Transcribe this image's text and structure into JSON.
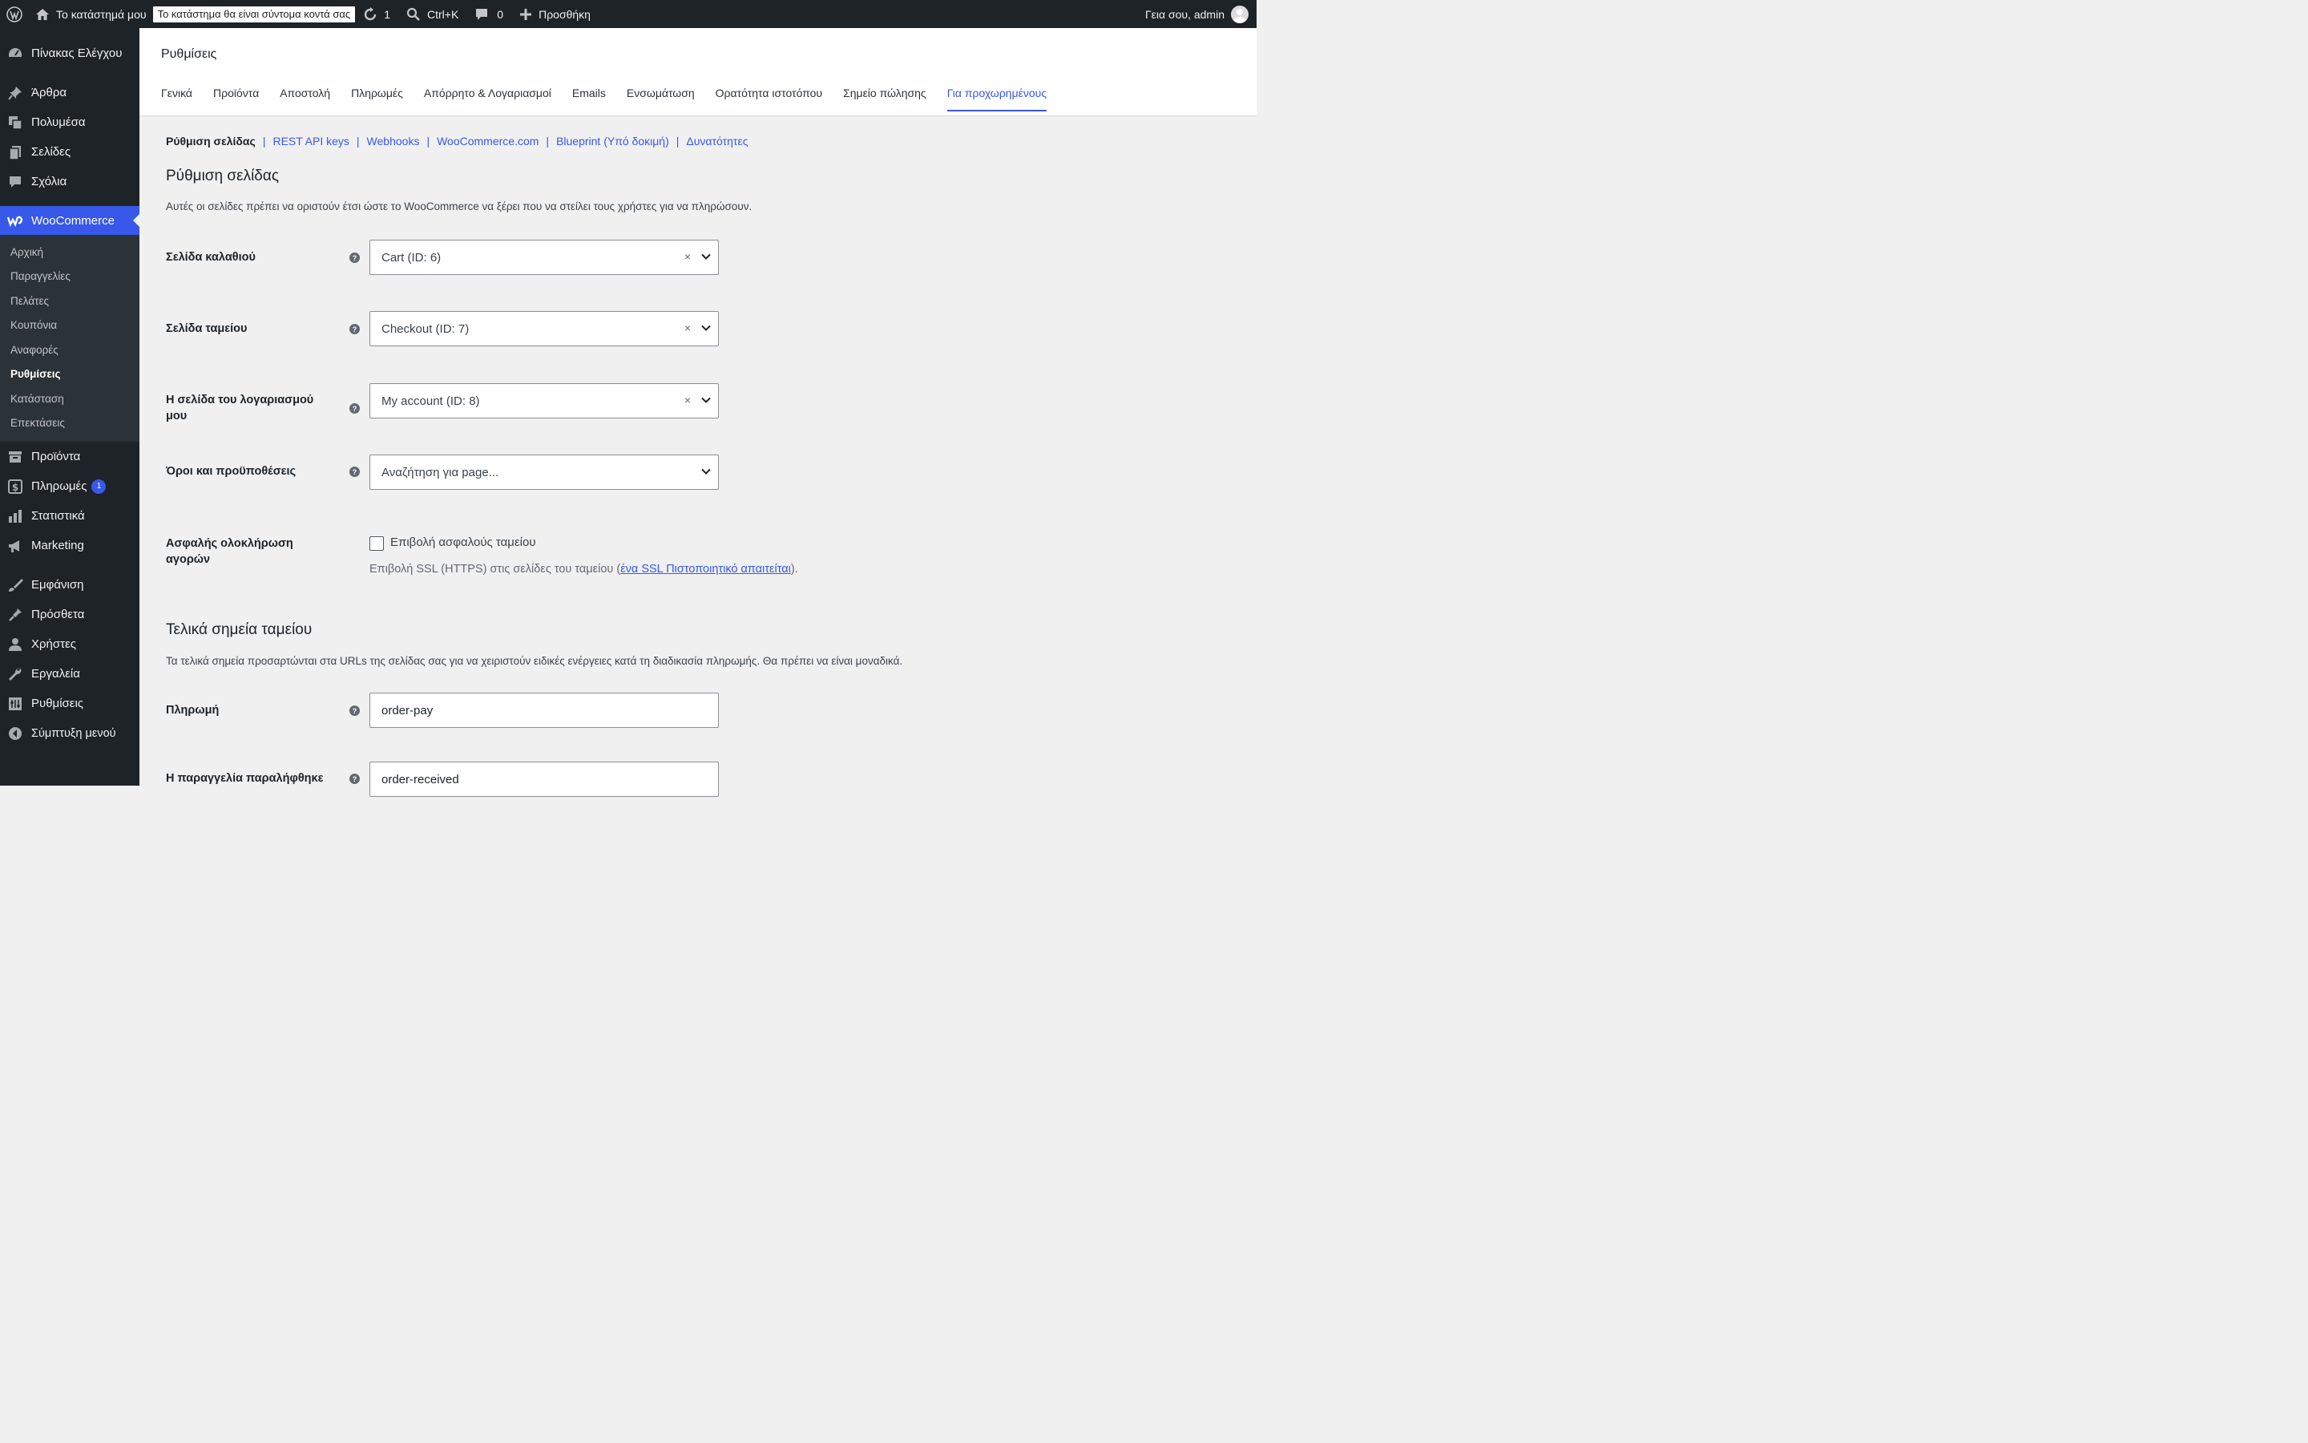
{
  "admin_bar": {
    "site_name": "Το κατάστημά μου",
    "maintenance_notice": "Το κατάστημα θα είναι σύντομα κοντά σας",
    "updates_count": "1",
    "command_shortcut": "Ctrl+K",
    "comments_count": "0",
    "new_label": "Προσθήκη",
    "greeting": "Γεια σου, admin"
  },
  "sidebar": {
    "dashboard": "Πίνακας Ελέγχου",
    "posts": "Άρθρα",
    "media": "Πολυμέσα",
    "pages": "Σελίδες",
    "comments": "Σχόλια",
    "woocommerce": "WooCommerce",
    "woo_sub": [
      "Αρχική",
      "Παραγγελίες",
      "Πελάτες",
      "Κουπόνια",
      "Αναφορές",
      "Ρυθμίσεις",
      "Κατάσταση",
      "Επεκτάσεις"
    ],
    "products": "Προϊόντα",
    "payments": "Πληρωμές",
    "payments_badge": "1",
    "analytics": "Στατιστικά",
    "marketing": "Marketing",
    "appearance": "Εμφάνιση",
    "plugins": "Πρόσθετα",
    "users": "Χρήστες",
    "tools": "Εργαλεία",
    "settings": "Ρυθμίσεις",
    "collapse": "Σύμπτυξη μενού"
  },
  "page": {
    "title": "Ρυθμίσεις",
    "tabs": [
      "Γενικά",
      "Προϊόντα",
      "Αποστολή",
      "Πληρωμές",
      "Απόρρητο & Λογαριασμοί",
      "Emails",
      "Ενσωμάτωση",
      "Ορατότητα ιστοτόπου",
      "Σημείο πώλησης",
      "Για προχωρημένους"
    ],
    "active_tab": "Για προχωρημένους",
    "subsections": [
      "Ρύθμιση σελίδας",
      "REST API keys",
      "Webhooks",
      "WooCommerce.com",
      "Blueprint (Υπό δοκιμή)",
      "Δυνατότητες"
    ]
  },
  "page_setup": {
    "heading": "Ρύθμιση σελίδας",
    "description": "Αυτές οι σελίδες πρέπει να οριστούν έτσι ώστε το WooCommerce να ξέρει που να στείλει τους χρήστες για να πληρώσουν.",
    "cart_label": "Σελίδα καλαθιού",
    "cart_value": "Cart (ID: 6)",
    "checkout_label": "Σελίδα ταμείου",
    "checkout_value": "Checkout (ID: 7)",
    "account_label": "Η σελίδα του λογαριασμού μου",
    "account_value": "My account (ID: 8)",
    "terms_label": "Όροι και προϋποθέσεις",
    "terms_placeholder": "Αναζήτηση για page...",
    "secure_label": "Ασφαλής ολοκλήρωση αγορών",
    "force_ssl_label": "Επιβολή ασφαλούς ταμείου",
    "ssl_desc_prefix": "Επιβολή SSL (HTTPS) στις σελίδες του ταμείου (",
    "ssl_link": "ένα SSL Πιστοποιητικό απαιτείται",
    "ssl_desc_suffix": ")."
  },
  "endpoints": {
    "heading": "Τελικά σημεία ταμείου",
    "description": "Τα τελικά σημεία προσαρτώνται στα URLs της σελίδας σας για να χειριστούν ειδικές ενέργειες κατά τη διαδικασία πληρωμής. Θα πρέπει να είναι μοναδικά.",
    "pay_label": "Πληρωμή",
    "pay_value": "order-pay",
    "received_label": "Η παραγγελία παραλήφθηκε",
    "received_value": "order-received"
  },
  "colors": {
    "accent": "#3858e9",
    "adminbar_bg": "#1d2327"
  }
}
